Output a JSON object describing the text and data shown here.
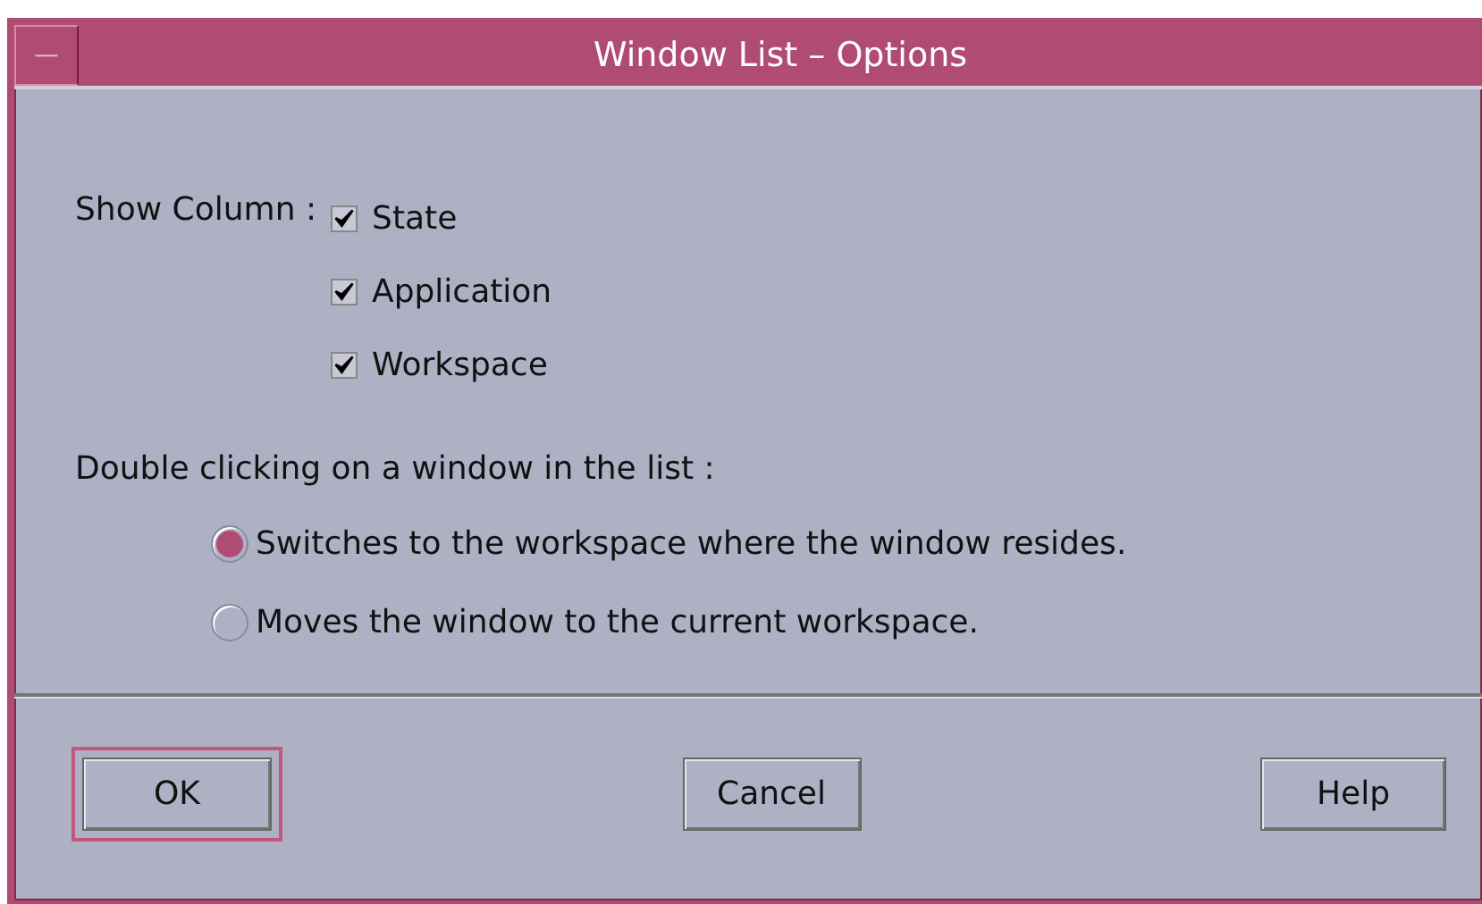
{
  "window": {
    "title": "Window List – Options",
    "menu_button": "—"
  },
  "show_column": {
    "label": "Show Column :",
    "options": [
      {
        "label": "State",
        "checked": true
      },
      {
        "label": "Application",
        "checked": true
      },
      {
        "label": "Workspace",
        "checked": true
      }
    ]
  },
  "double_click": {
    "label": "Double clicking on a window in the list :",
    "options": [
      {
        "label": "Switches to the workspace where the window resides.",
        "selected": true
      },
      {
        "label": "Moves the window to the current workspace.",
        "selected": false
      }
    ]
  },
  "buttons": [
    {
      "label": "OK",
      "default": true
    },
    {
      "label": "Cancel",
      "default": false
    },
    {
      "label": "Help",
      "default": false
    }
  ]
}
